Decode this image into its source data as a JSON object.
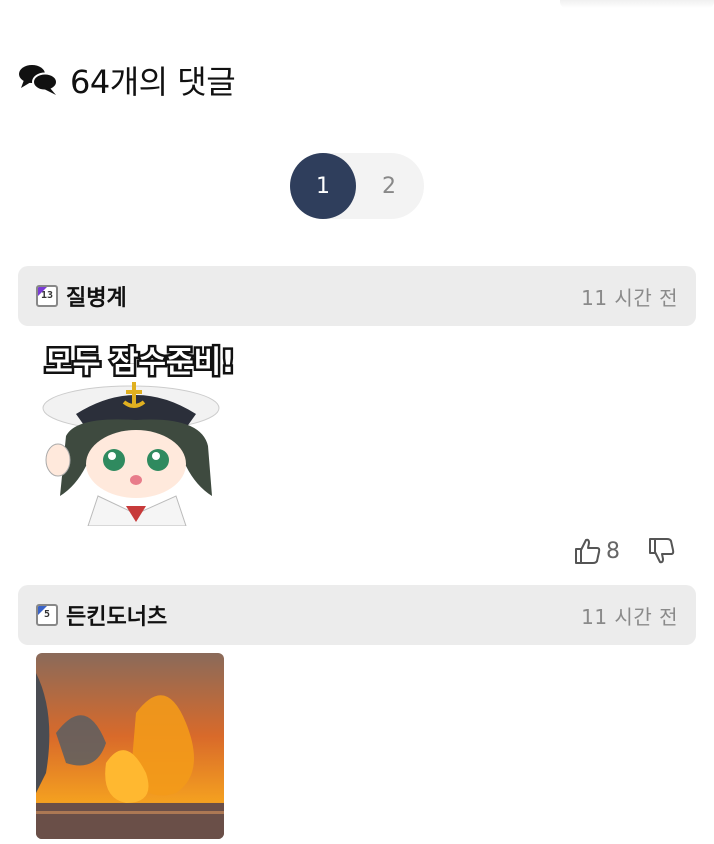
{
  "comments_header": {
    "title": "64개의 댓글",
    "icon": "speech-bubbles-icon"
  },
  "pagination": {
    "pages": [
      "1",
      "2"
    ],
    "current": "1"
  },
  "comments": [
    {
      "author": "질병계",
      "level": "13",
      "time": "11 시간 전",
      "sticker_text": "모두 잠수준비!",
      "likes": "8"
    },
    {
      "author": "든킨도너츠",
      "level": "5",
      "time": "11 시간 전"
    }
  ],
  "colors": {
    "pager_active": "#2f3e5c",
    "header_bg": "#ececec",
    "time_text": "#8a8a8a"
  }
}
